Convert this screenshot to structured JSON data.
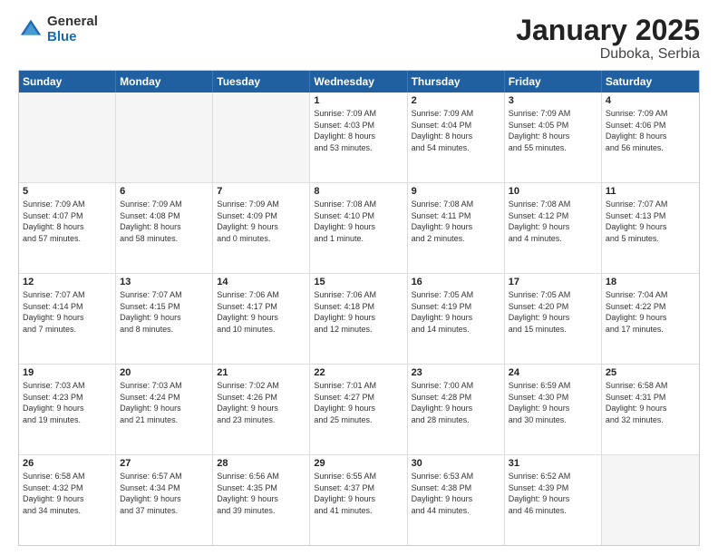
{
  "logo": {
    "general": "General",
    "blue": "Blue"
  },
  "title": {
    "month": "January 2025",
    "location": "Duboka, Serbia"
  },
  "header": {
    "days": [
      "Sunday",
      "Monday",
      "Tuesday",
      "Wednesday",
      "Thursday",
      "Friday",
      "Saturday"
    ]
  },
  "weeks": [
    [
      {
        "day": "",
        "text": ""
      },
      {
        "day": "",
        "text": ""
      },
      {
        "day": "",
        "text": ""
      },
      {
        "day": "1",
        "text": "Sunrise: 7:09 AM\nSunset: 4:03 PM\nDaylight: 8 hours\nand 53 minutes."
      },
      {
        "day": "2",
        "text": "Sunrise: 7:09 AM\nSunset: 4:04 PM\nDaylight: 8 hours\nand 54 minutes."
      },
      {
        "day": "3",
        "text": "Sunrise: 7:09 AM\nSunset: 4:05 PM\nDaylight: 8 hours\nand 55 minutes."
      },
      {
        "day": "4",
        "text": "Sunrise: 7:09 AM\nSunset: 4:06 PM\nDaylight: 8 hours\nand 56 minutes."
      }
    ],
    [
      {
        "day": "5",
        "text": "Sunrise: 7:09 AM\nSunset: 4:07 PM\nDaylight: 8 hours\nand 57 minutes."
      },
      {
        "day": "6",
        "text": "Sunrise: 7:09 AM\nSunset: 4:08 PM\nDaylight: 8 hours\nand 58 minutes."
      },
      {
        "day": "7",
        "text": "Sunrise: 7:09 AM\nSunset: 4:09 PM\nDaylight: 9 hours\nand 0 minutes."
      },
      {
        "day": "8",
        "text": "Sunrise: 7:08 AM\nSunset: 4:10 PM\nDaylight: 9 hours\nand 1 minute."
      },
      {
        "day": "9",
        "text": "Sunrise: 7:08 AM\nSunset: 4:11 PM\nDaylight: 9 hours\nand 2 minutes."
      },
      {
        "day": "10",
        "text": "Sunrise: 7:08 AM\nSunset: 4:12 PM\nDaylight: 9 hours\nand 4 minutes."
      },
      {
        "day": "11",
        "text": "Sunrise: 7:07 AM\nSunset: 4:13 PM\nDaylight: 9 hours\nand 5 minutes."
      }
    ],
    [
      {
        "day": "12",
        "text": "Sunrise: 7:07 AM\nSunset: 4:14 PM\nDaylight: 9 hours\nand 7 minutes."
      },
      {
        "day": "13",
        "text": "Sunrise: 7:07 AM\nSunset: 4:15 PM\nDaylight: 9 hours\nand 8 minutes."
      },
      {
        "day": "14",
        "text": "Sunrise: 7:06 AM\nSunset: 4:17 PM\nDaylight: 9 hours\nand 10 minutes."
      },
      {
        "day": "15",
        "text": "Sunrise: 7:06 AM\nSunset: 4:18 PM\nDaylight: 9 hours\nand 12 minutes."
      },
      {
        "day": "16",
        "text": "Sunrise: 7:05 AM\nSunset: 4:19 PM\nDaylight: 9 hours\nand 14 minutes."
      },
      {
        "day": "17",
        "text": "Sunrise: 7:05 AM\nSunset: 4:20 PM\nDaylight: 9 hours\nand 15 minutes."
      },
      {
        "day": "18",
        "text": "Sunrise: 7:04 AM\nSunset: 4:22 PM\nDaylight: 9 hours\nand 17 minutes."
      }
    ],
    [
      {
        "day": "19",
        "text": "Sunrise: 7:03 AM\nSunset: 4:23 PM\nDaylight: 9 hours\nand 19 minutes."
      },
      {
        "day": "20",
        "text": "Sunrise: 7:03 AM\nSunset: 4:24 PM\nDaylight: 9 hours\nand 21 minutes."
      },
      {
        "day": "21",
        "text": "Sunrise: 7:02 AM\nSunset: 4:26 PM\nDaylight: 9 hours\nand 23 minutes."
      },
      {
        "day": "22",
        "text": "Sunrise: 7:01 AM\nSunset: 4:27 PM\nDaylight: 9 hours\nand 25 minutes."
      },
      {
        "day": "23",
        "text": "Sunrise: 7:00 AM\nSunset: 4:28 PM\nDaylight: 9 hours\nand 28 minutes."
      },
      {
        "day": "24",
        "text": "Sunrise: 6:59 AM\nSunset: 4:30 PM\nDaylight: 9 hours\nand 30 minutes."
      },
      {
        "day": "25",
        "text": "Sunrise: 6:58 AM\nSunset: 4:31 PM\nDaylight: 9 hours\nand 32 minutes."
      }
    ],
    [
      {
        "day": "26",
        "text": "Sunrise: 6:58 AM\nSunset: 4:32 PM\nDaylight: 9 hours\nand 34 minutes."
      },
      {
        "day": "27",
        "text": "Sunrise: 6:57 AM\nSunset: 4:34 PM\nDaylight: 9 hours\nand 37 minutes."
      },
      {
        "day": "28",
        "text": "Sunrise: 6:56 AM\nSunset: 4:35 PM\nDaylight: 9 hours\nand 39 minutes."
      },
      {
        "day": "29",
        "text": "Sunrise: 6:55 AM\nSunset: 4:37 PM\nDaylight: 9 hours\nand 41 minutes."
      },
      {
        "day": "30",
        "text": "Sunrise: 6:53 AM\nSunset: 4:38 PM\nDaylight: 9 hours\nand 44 minutes."
      },
      {
        "day": "31",
        "text": "Sunrise: 6:52 AM\nSunset: 4:39 PM\nDaylight: 9 hours\nand 46 minutes."
      },
      {
        "day": "",
        "text": ""
      }
    ]
  ]
}
